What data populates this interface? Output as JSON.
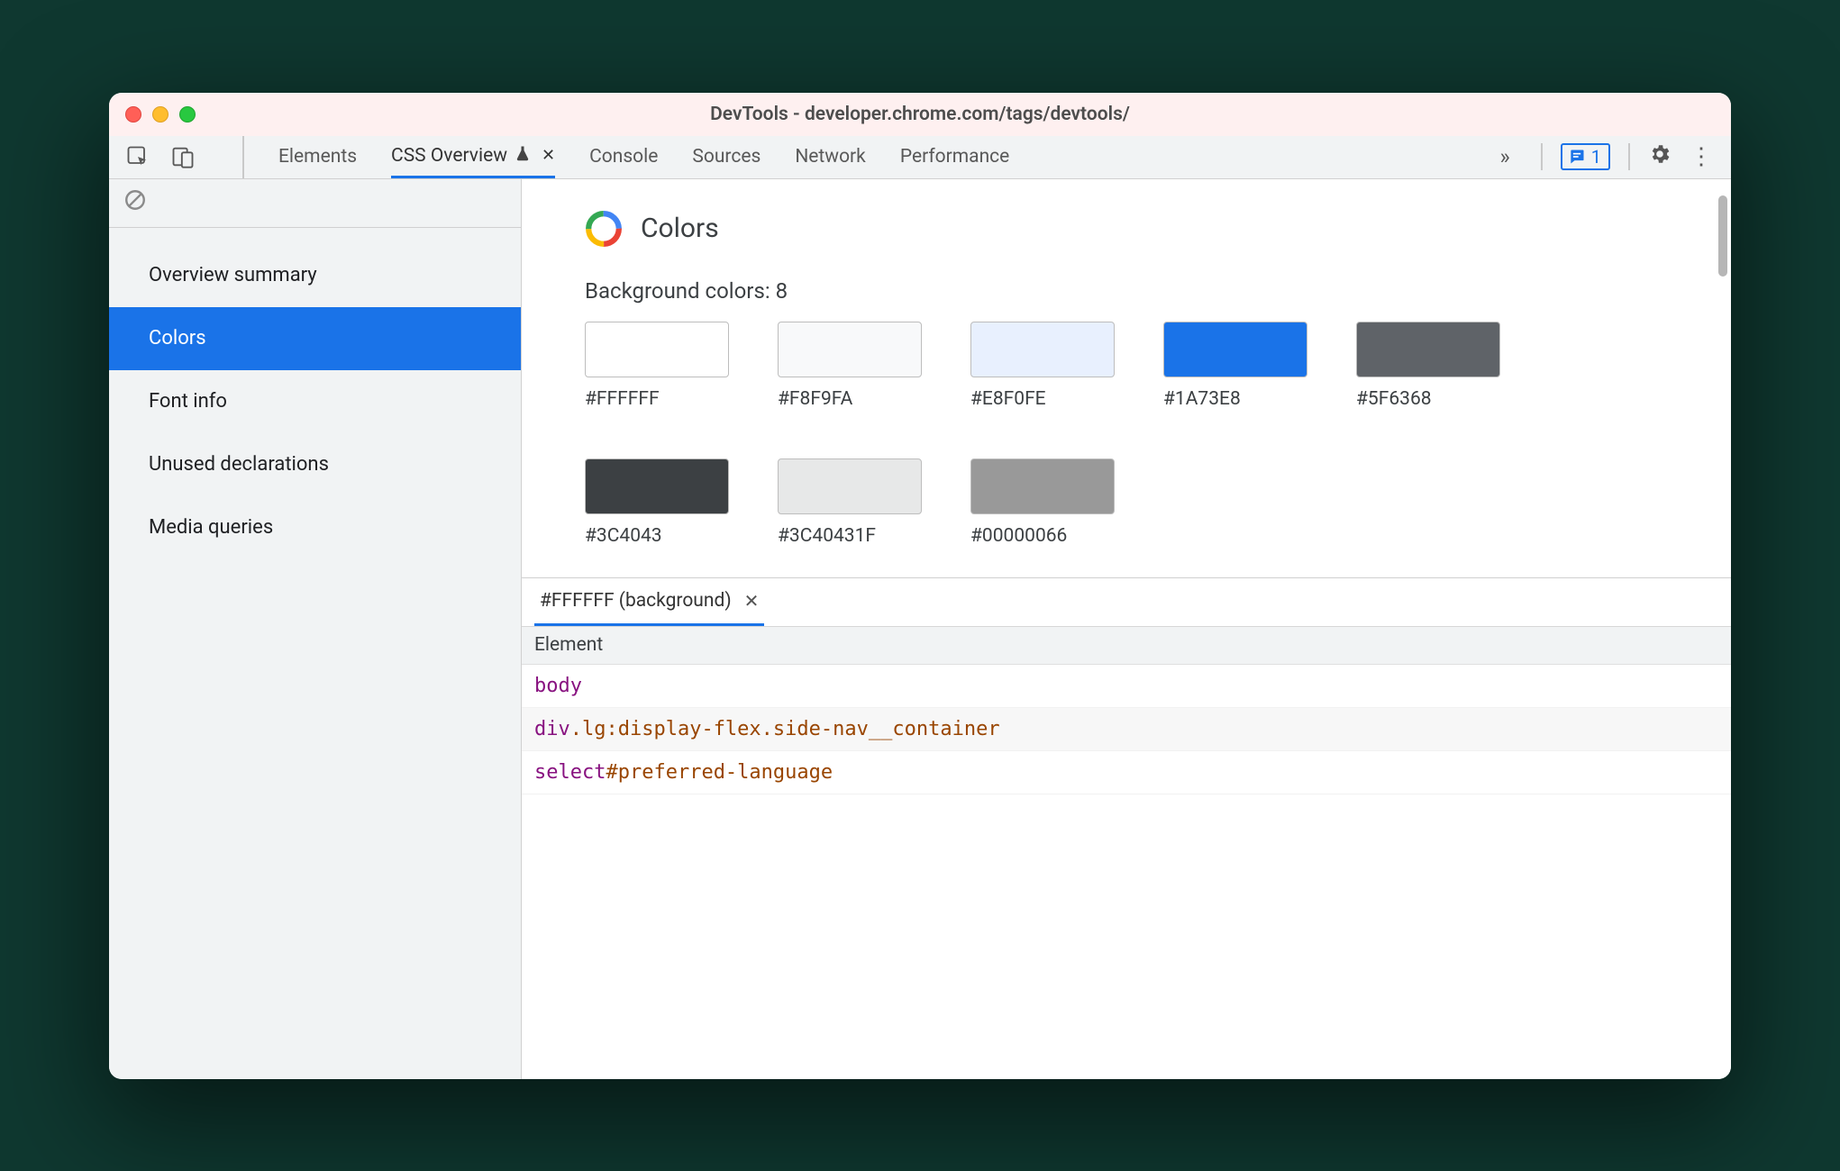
{
  "window": {
    "title": "DevTools - developer.chrome.com/tags/devtools/"
  },
  "tabstrip": {
    "tabs": [
      {
        "label": "Elements",
        "active": false
      },
      {
        "label": "CSS Overview",
        "active": true,
        "experimental": true,
        "closable": true
      },
      {
        "label": "Console",
        "active": false
      },
      {
        "label": "Sources",
        "active": false
      },
      {
        "label": "Network",
        "active": false
      },
      {
        "label": "Performance",
        "active": false
      }
    ],
    "issues_count": "1"
  },
  "sidebar": {
    "items": [
      {
        "label": "Overview summary",
        "selected": false
      },
      {
        "label": "Colors",
        "selected": true
      },
      {
        "label": "Font info",
        "selected": false
      },
      {
        "label": "Unused declarations",
        "selected": false
      },
      {
        "label": "Media queries",
        "selected": false
      }
    ]
  },
  "colors": {
    "section_title": "Colors",
    "subhead": "Background colors: 8",
    "swatches": [
      {
        "hex": "#FFFFFF",
        "css": "#FFFFFF"
      },
      {
        "hex": "#F8F9FA",
        "css": "#F8F9FA"
      },
      {
        "hex": "#E8F0FE",
        "css": "#E8F0FE"
      },
      {
        "hex": "#1A73E8",
        "css": "#1A73E8"
      },
      {
        "hex": "#5F6368",
        "css": "#5F6368"
      },
      {
        "hex": "#3C4043",
        "css": "#3C4043"
      },
      {
        "hex": "#3C40431F",
        "css": "rgba(60,64,67,0.12)"
      },
      {
        "hex": "#00000066",
        "css": "rgba(0,0,0,0.40)"
      }
    ]
  },
  "detail": {
    "tab_label": "#FFFFFF (background)",
    "table_header": "Element",
    "rows": [
      [
        {
          "t": "tag",
          "v": "body"
        }
      ],
      [
        {
          "t": "tag",
          "v": "div"
        },
        {
          "t": "class",
          "v": ".lg:display-flex.side-nav__container"
        }
      ],
      [
        {
          "t": "tag",
          "v": "select"
        },
        {
          "t": "id",
          "v": "#preferred-language"
        }
      ]
    ]
  }
}
